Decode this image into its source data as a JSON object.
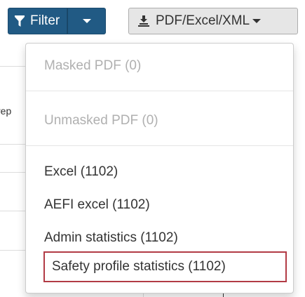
{
  "toolbar": {
    "filter_label": "Filter",
    "export_label": "PDF/Excel/XML",
    "colors": {
      "primary": "#215a84",
      "secondary_bg": "#e6e6e6",
      "highlight_border": "#b23b45"
    }
  },
  "background": {
    "clipped_header_text": "rep"
  },
  "dropdown": {
    "items": [
      {
        "label": "Masked PDF (0)",
        "disabled": true
      },
      {
        "label": "Unmasked PDF (0)",
        "disabled": true
      },
      {
        "label": "Excel (1102)",
        "disabled": false
      },
      {
        "label": "AEFI excel (1102)",
        "disabled": false
      },
      {
        "label": "Admin statistics (1102)",
        "disabled": false
      },
      {
        "label": "Safety profile statistics (1102)",
        "disabled": false,
        "highlighted": true
      }
    ]
  }
}
